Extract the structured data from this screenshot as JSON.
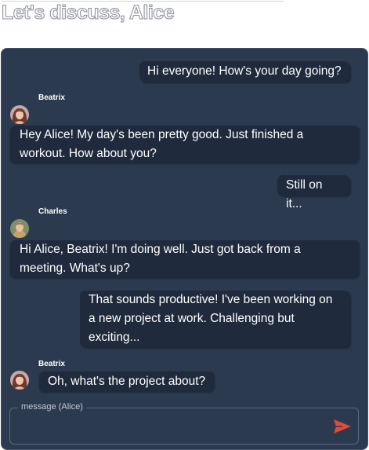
{
  "page": {
    "title": "Let's discuss, Alice"
  },
  "messages": [
    {
      "side": "right",
      "text": "Hi everyone! How's your day going?"
    },
    {
      "side": "left",
      "sender": "Beatrix",
      "avatar": "beatrix",
      "text": "Hey Alice! My day's been pretty good. Just finished a workout. How about you?"
    },
    {
      "side": "right",
      "text": "Still on it..."
    },
    {
      "side": "left",
      "sender": "Charles",
      "avatar": "charles",
      "text": "Hi Alice, Beatrix! I'm doing well. Just got back from a meeting. What's up?"
    },
    {
      "side": "right",
      "text": "That sounds productive! I've been working on a new project at work. Challenging but exciting..."
    },
    {
      "side": "left",
      "sender": "Beatrix",
      "avatar": "beatrix",
      "text": "Oh, what's the project about?"
    }
  ],
  "composer": {
    "label": "message (Alice)",
    "value": "",
    "send_icon": "send-icon"
  },
  "colors": {
    "panel": "#2c3a50",
    "bubble": "#1f2b3d",
    "send": "#e4493a"
  }
}
